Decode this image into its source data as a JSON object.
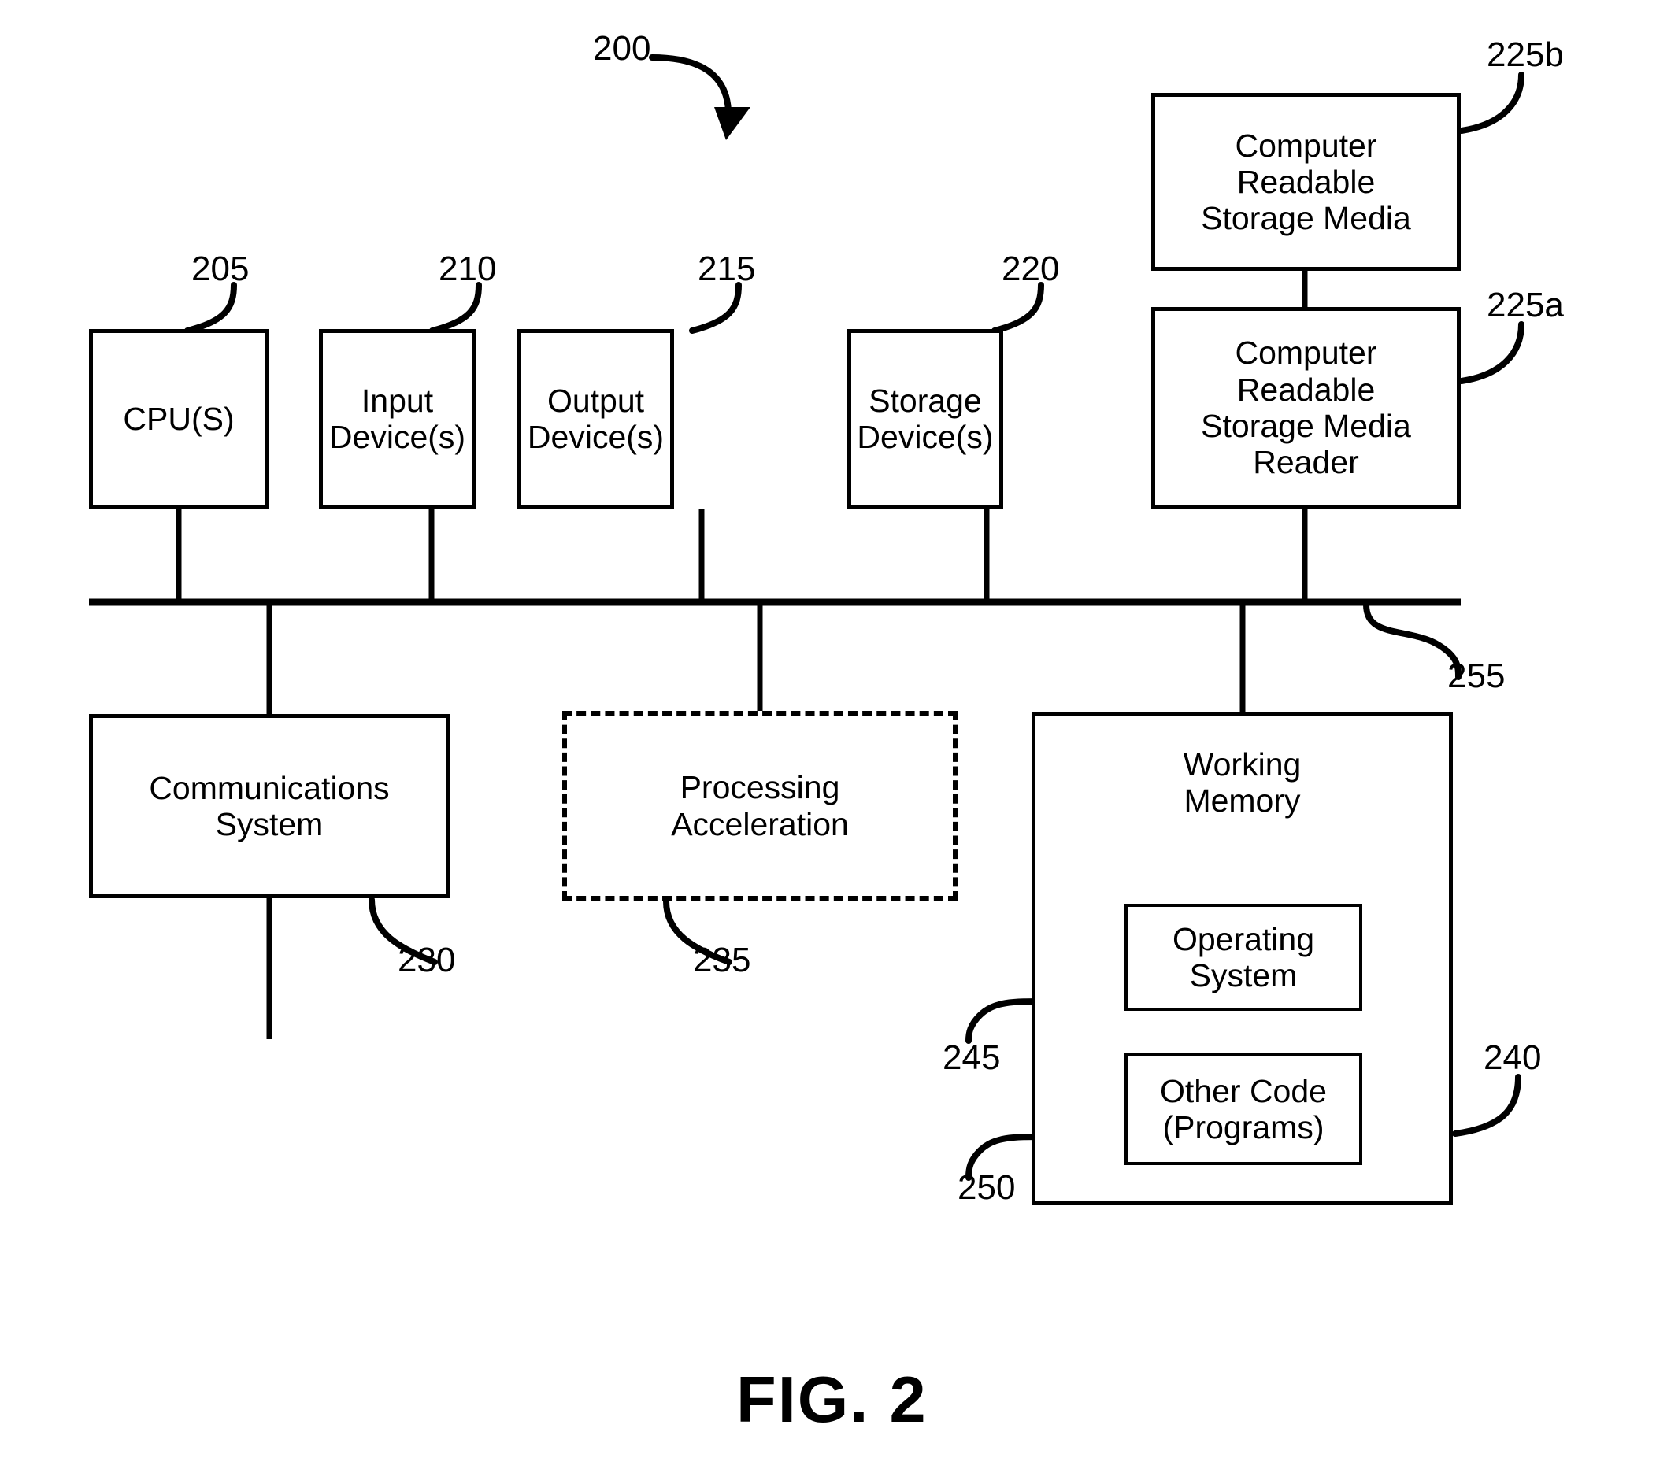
{
  "figure": {
    "caption": "FIG. 2",
    "system_ref": "200"
  },
  "nodes": [
    {
      "id": "cpu",
      "label": "CPU(S)",
      "ref": "205",
      "style": "solid"
    },
    {
      "id": "input",
      "label": "Input\nDevice(s)",
      "ref": "210",
      "style": "solid"
    },
    {
      "id": "output",
      "label": "Output\nDevice(s)",
      "ref": "215",
      "style": "solid"
    },
    {
      "id": "storage",
      "label": "Storage\nDevice(s)",
      "ref": "220",
      "style": "solid"
    },
    {
      "id": "crsm",
      "label": "Computer\nReadable\nStorage Media",
      "ref": "225b",
      "style": "solid"
    },
    {
      "id": "crsmr",
      "label": "Computer\nReadable\nStorage Media\nReader",
      "ref": "225a",
      "style": "solid"
    },
    {
      "id": "comm",
      "label": "Communications\nSystem",
      "ref": "230",
      "style": "solid"
    },
    {
      "id": "procaccel",
      "label": "Processing\nAcceleration",
      "ref": "235",
      "style": "dashed"
    },
    {
      "id": "workingmem",
      "label": "Working\nMemory",
      "ref": "240",
      "style": "solid"
    },
    {
      "id": "os",
      "label": "Operating\nSystem",
      "ref": "245",
      "style": "solid"
    },
    {
      "id": "othercode",
      "label": "Other Code\n(Programs)",
      "ref": "250",
      "style": "solid"
    }
  ],
  "bus": {
    "ref": "255",
    "label": "bus"
  },
  "refs": {
    "r200": "200",
    "r205": "205",
    "r210": "210",
    "r215": "215",
    "r220": "220",
    "r225b": "225b",
    "r225a": "225a",
    "r230": "230",
    "r235": "235",
    "r240": "240",
    "r245": "245",
    "r250": "250",
    "r255": "255"
  },
  "colors": {
    "ink": "#000000",
    "paper": "#ffffff"
  }
}
